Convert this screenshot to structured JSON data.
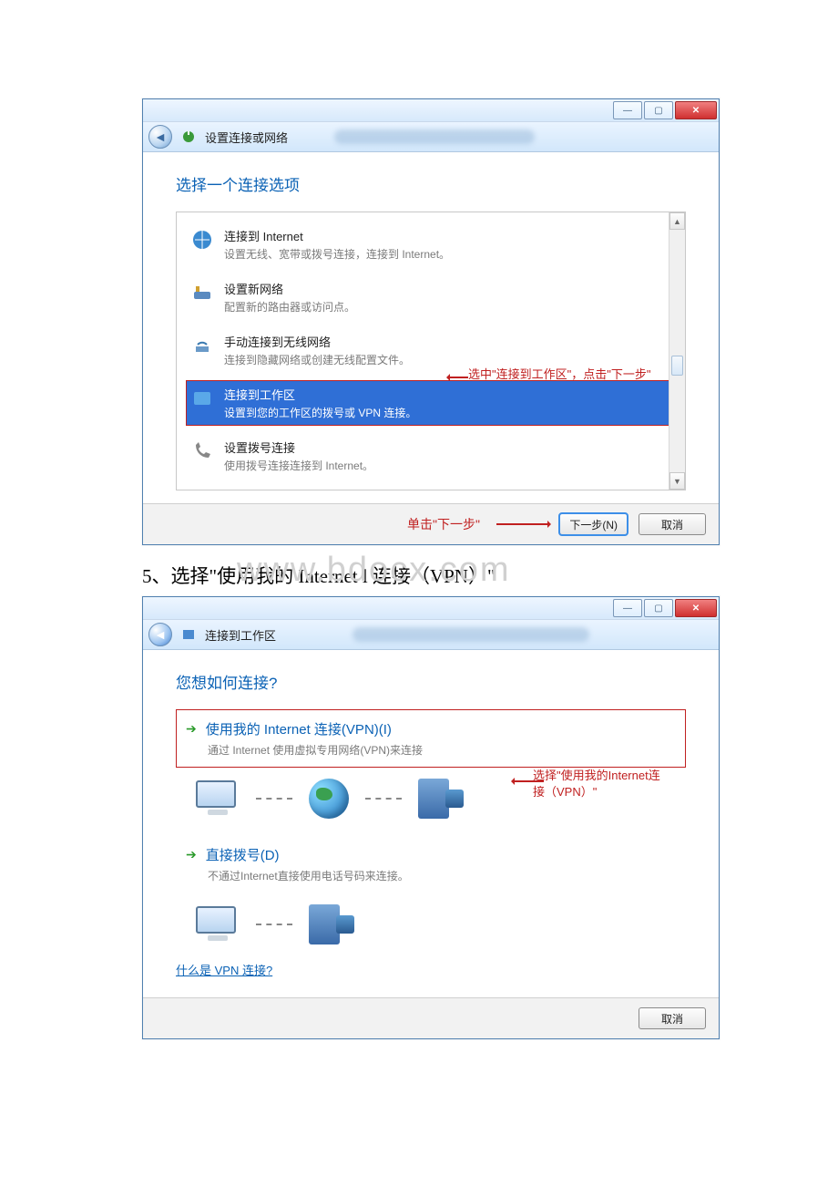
{
  "watermark": "www.bdocx.com",
  "step_caption": "5、选择\"使用我的 Internet l 连接（VPN）\"",
  "win1": {
    "title": "设置连接或网络",
    "heading": "选择一个连接选项",
    "options": [
      {
        "title": "连接到 Internet",
        "desc": "设置无线、宽带或拨号连接，连接到 Internet。"
      },
      {
        "title": "设置新网络",
        "desc": "配置新的路由器或访问点。"
      },
      {
        "title": "手动连接到无线网络",
        "desc": "连接到隐藏网络或创建无线配置文件。"
      },
      {
        "title": "连接到工作区",
        "desc": "设置到您的工作区的拨号或 VPN 连接。"
      },
      {
        "title": "设置拨号连接",
        "desc": "使用拨号连接连接到 Internet。"
      }
    ],
    "annotation": "选中\"连接到工作区\"，点击\"下一步\"",
    "footer_note": "单击\"下一步\"",
    "next_btn": "下一步(N)",
    "cancel_btn": "取消"
  },
  "win2": {
    "title": "连接到工作区",
    "heading": "您想如何连接?",
    "options": [
      {
        "title": "使用我的 Internet 连接(VPN)(I)",
        "desc": "通过 Internet 使用虚拟专用网络(VPN)来连接"
      },
      {
        "title": "直接拨号(D)",
        "desc": "不通过Internet直接使用电话号码来连接。"
      }
    ],
    "annotation": "选择\"使用我的Internet连接（VPN）\"",
    "help_link": "什么是 VPN 连接?",
    "cancel_btn": "取消"
  }
}
